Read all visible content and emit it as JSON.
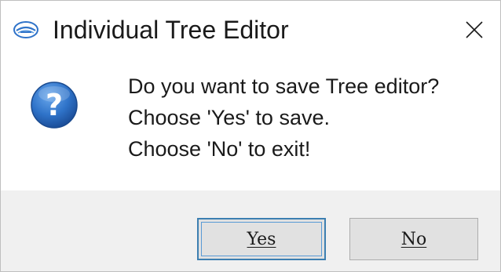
{
  "window": {
    "title": "Individual Tree Editor",
    "icon": "app-logo-icon",
    "close_icon": "close-icon"
  },
  "message": {
    "icon": "question-icon",
    "lines": [
      "Do you want to save Tree editor?",
      "Choose 'Yes' to save.",
      "Choose 'No' to exit!"
    ]
  },
  "buttons": {
    "yes_label": "Yes",
    "no_label": "No",
    "default": "yes"
  },
  "colors": {
    "icon_blue": "#2f73c9",
    "focus_border": "#3c7fb1",
    "footer_bg": "#f0f0f0"
  }
}
